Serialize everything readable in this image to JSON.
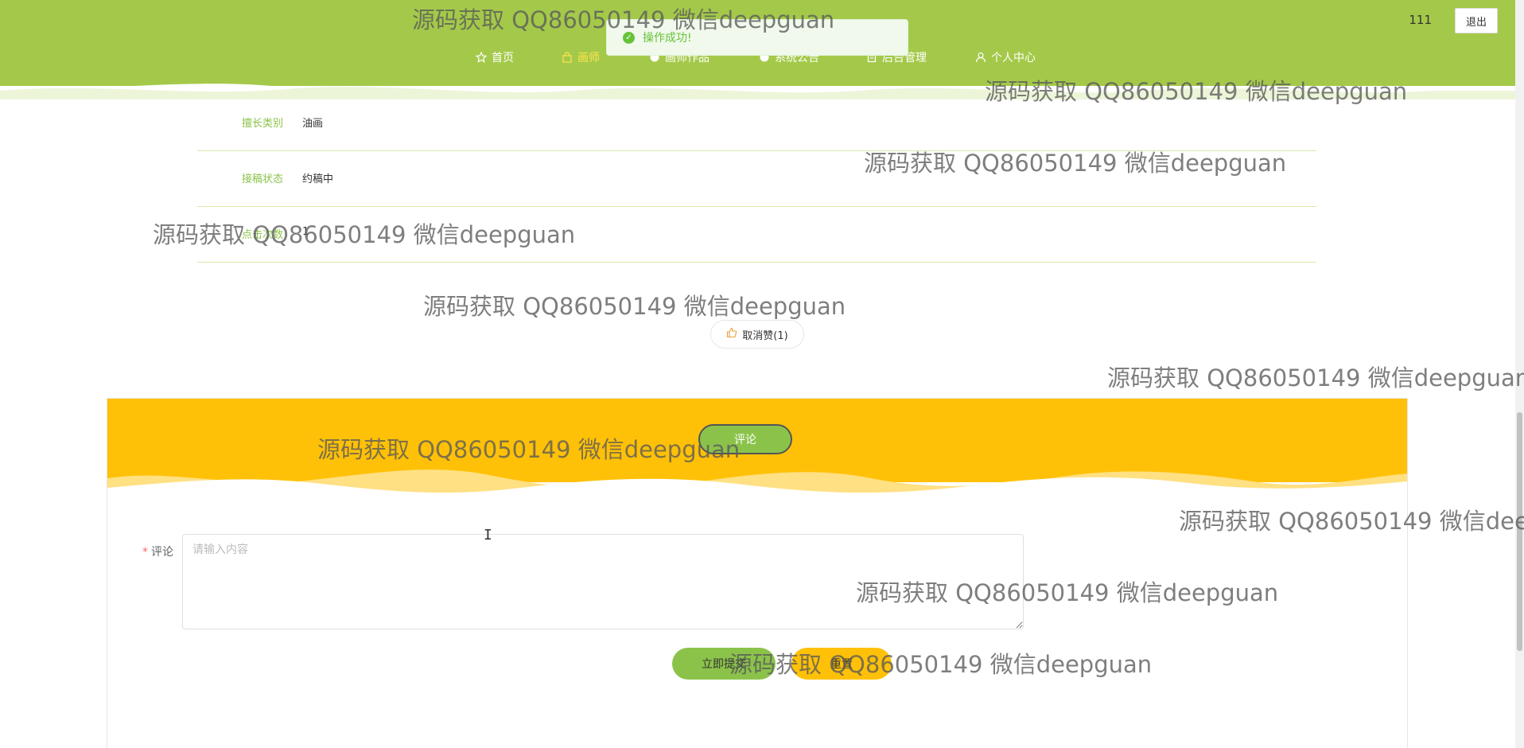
{
  "header": {
    "nav": [
      {
        "label": "首页",
        "icon": "star-icon"
      },
      {
        "label": "画师",
        "icon": "bag-icon",
        "active": true
      },
      {
        "label": "画师作品",
        "icon": "circle-icon"
      },
      {
        "label": "系统公告",
        "icon": "circle-icon"
      },
      {
        "label": "后台管理",
        "icon": "doc-icon"
      },
      {
        "label": "个人中心",
        "icon": "user-icon"
      }
    ],
    "user_name": "111",
    "logout_label": "退出",
    "brand_color": "#8bc34a"
  },
  "toast": {
    "message": "操作成功!"
  },
  "info_rows": [
    {
      "label": "擅长类别",
      "value": "油画"
    },
    {
      "label": "接稿状态",
      "value": "约稿中"
    },
    {
      "label": "点击次数",
      "value": "1"
    }
  ],
  "like_button": {
    "label": "取消赞(1)"
  },
  "comment": {
    "tab_label": "评论",
    "field_label": "评论",
    "required_mark": "*",
    "placeholder": "请输入内容",
    "submit_label": "立即提交",
    "reset_label": "重置",
    "accent_color": "#ffc107"
  },
  "watermark": "源码获取 QQ86050149 微信deepguan"
}
